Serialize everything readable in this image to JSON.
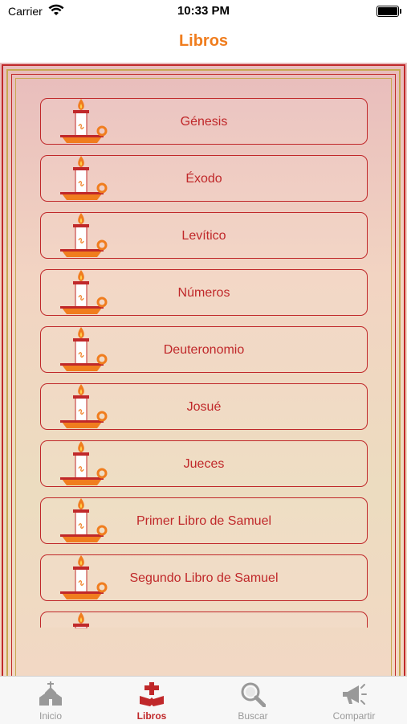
{
  "status": {
    "carrier": "Carrier",
    "time": "10:33 PM"
  },
  "nav": {
    "title": "Libros"
  },
  "books": [
    {
      "label": "Génesis"
    },
    {
      "label": "Éxodo"
    },
    {
      "label": "Levítico"
    },
    {
      "label": "Números"
    },
    {
      "label": "Deuteronomio"
    },
    {
      "label": "Josué"
    },
    {
      "label": "Jueces"
    },
    {
      "label": "Primer Libro de Samuel"
    },
    {
      "label": "Segundo Libro de Samuel"
    }
  ],
  "tabs": [
    {
      "label": "Inicio",
      "icon": "church-icon"
    },
    {
      "label": "Libros",
      "icon": "bible-cross-icon"
    },
    {
      "label": "Buscar",
      "icon": "magnifier-icon"
    },
    {
      "label": "Compartir",
      "icon": "megaphone-icon"
    }
  ],
  "colors": {
    "accent": "#c0282a",
    "title": "#f07d1e",
    "gold": "#c8a850",
    "tab_inactive": "#999999"
  }
}
